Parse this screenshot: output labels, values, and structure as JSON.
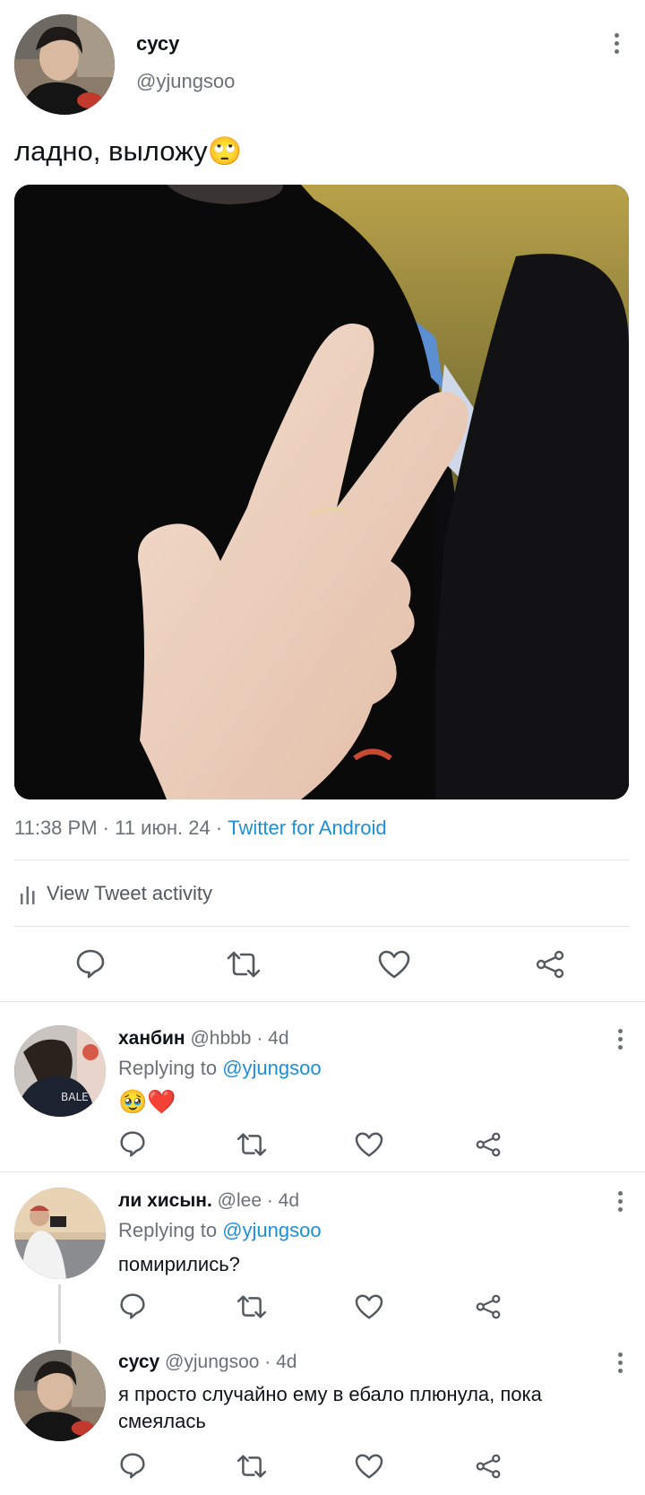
{
  "tweet": {
    "author_name": "сусу",
    "author_handle": "@yjungsoo",
    "text": "ладно, выложу",
    "emoji": "🙄",
    "time": "11:38 PM",
    "separator": "·",
    "date": "11 июн. 24",
    "source": "Twitter for Android",
    "activity_label": "View Tweet activity"
  },
  "actions_icons": [
    "reply-icon",
    "retweet-icon",
    "like-icon",
    "share-icon"
  ],
  "replies": [
    {
      "name": "ханбин",
      "handle": "@hbbb",
      "age": "· 4d",
      "replying_prefix": "Replying to",
      "replying_to": "@yjungsoo",
      "text": "🥹❤️"
    },
    {
      "name": "ли хисын.",
      "handle": "@lee",
      "age": "· 4d",
      "replying_prefix": "Replying to",
      "replying_to": "@yjungsoo",
      "text": "помирились?"
    },
    {
      "name": "сусу",
      "handle": "@yjungsoo",
      "age": "· 4d",
      "text": "я просто случайно ему в ебало плюнула, пока смеялась"
    }
  ],
  "colors": {
    "link": "#1d8fd9",
    "secondary_text": "#6b7176",
    "primary_text": "#0f1419",
    "divider": "#e1e5e8"
  }
}
